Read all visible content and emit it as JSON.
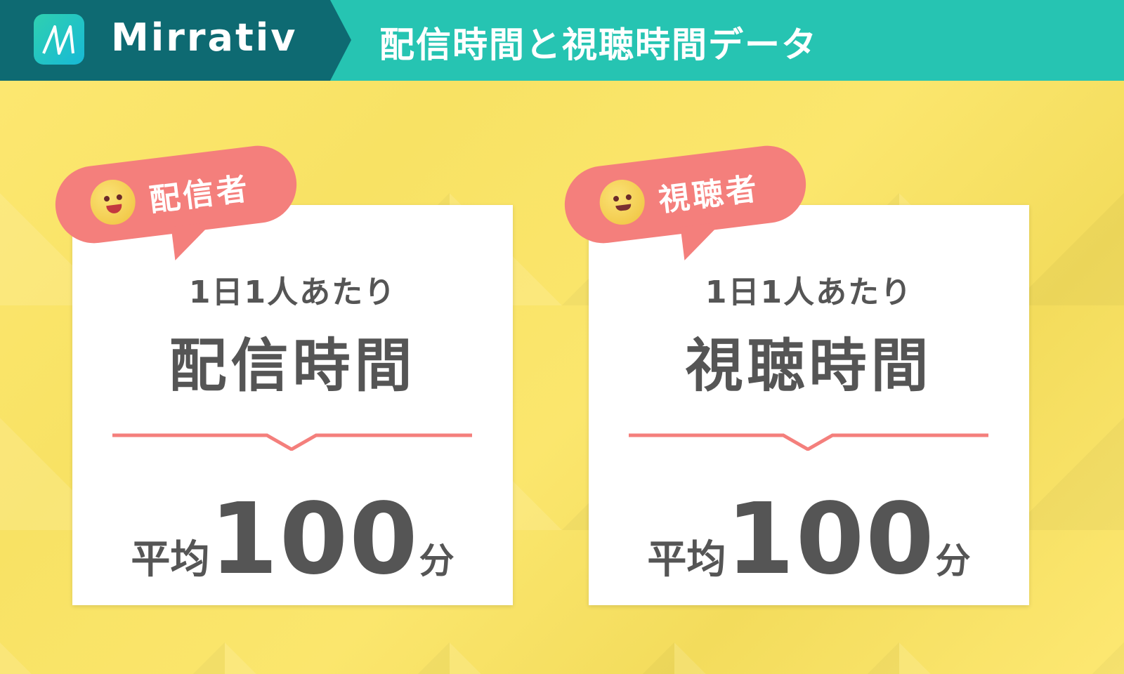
{
  "header": {
    "brand": "Mirrativ",
    "title": "配信時間と視聴時間データ",
    "logo_icon": "mirrativ-logo-icon"
  },
  "colors": {
    "header_dark": "#0e6a72",
    "header_teal": "#26c4b2",
    "background": "#fbe66d",
    "accent": "#f47f7c",
    "text": "#555555"
  },
  "cards": [
    {
      "badge": "配信者",
      "subtitle": "1日1人あたり",
      "label": "配信時間",
      "prefix": "平均",
      "value": "100",
      "unit": "分"
    },
    {
      "badge": "視聴者",
      "subtitle": "1日1人あたり",
      "label": "視聴時間",
      "prefix": "平均",
      "value": "100",
      "unit": "分"
    }
  ]
}
